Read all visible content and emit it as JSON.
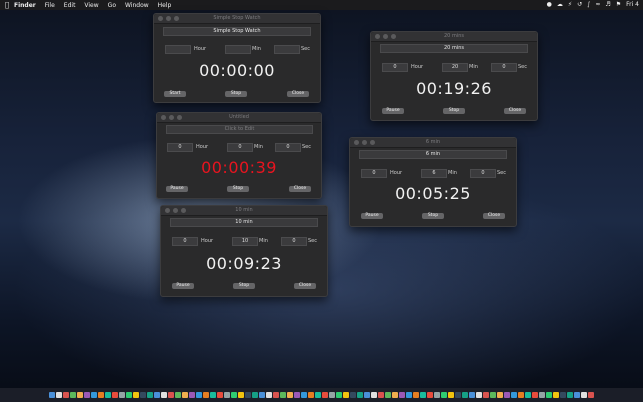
{
  "menubar": {
    "apple": "",
    "items": [
      "Finder",
      "File",
      "Edit",
      "View",
      "Go",
      "Window",
      "Help"
    ],
    "right_time": "Fri 4"
  },
  "windows": [
    {
      "id": "w1",
      "title": "Simple Stop Watch",
      "name": "Simple Stop Watch",
      "name_placeholder": false,
      "hour": "",
      "min": "",
      "sec": "",
      "time": "00:00:00",
      "red": false,
      "buttons": [
        "Start",
        "Stop",
        "Close"
      ]
    },
    {
      "id": "w2",
      "title": "20 mins",
      "name": "20 mins",
      "name_placeholder": false,
      "hour": "0",
      "min": "20",
      "sec": "0",
      "time": "00:19:26",
      "red": false,
      "buttons": [
        "Pause",
        "Stop",
        "Close"
      ]
    },
    {
      "id": "w3",
      "title": "Untitled",
      "name": "Click to Edit",
      "name_placeholder": true,
      "hour": "0",
      "min": "0",
      "sec": "0",
      "time": "00:00:39",
      "red": true,
      "buttons": [
        "Pause",
        "Stop",
        "Close"
      ]
    },
    {
      "id": "w4",
      "title": "6 min",
      "name": "6 min",
      "name_placeholder": false,
      "hour": "0",
      "min": "6",
      "sec": "0",
      "time": "00:05:25",
      "red": false,
      "buttons": [
        "Pause",
        "Stop",
        "Close"
      ]
    },
    {
      "id": "w5",
      "title": "10 min",
      "name": "10 min",
      "name_placeholder": false,
      "hour": "0",
      "min": "10",
      "sec": "0",
      "time": "00:09:23",
      "red": false,
      "buttons": [
        "Pause",
        "Stop",
        "Close"
      ]
    }
  ],
  "labels": {
    "hour": "Hour",
    "min": "Min",
    "sec": "Sec"
  },
  "dock_colors": [
    "#4a90d9",
    "#e0e0e0",
    "#d9534f",
    "#5cb85c",
    "#f0ad4e",
    "#9b59b6",
    "#3498db",
    "#e67e22",
    "#1abc9c",
    "#e74c3c",
    "#95a5a6",
    "#2ecc71",
    "#f1c40f",
    "#34495e",
    "#16a085"
  ]
}
